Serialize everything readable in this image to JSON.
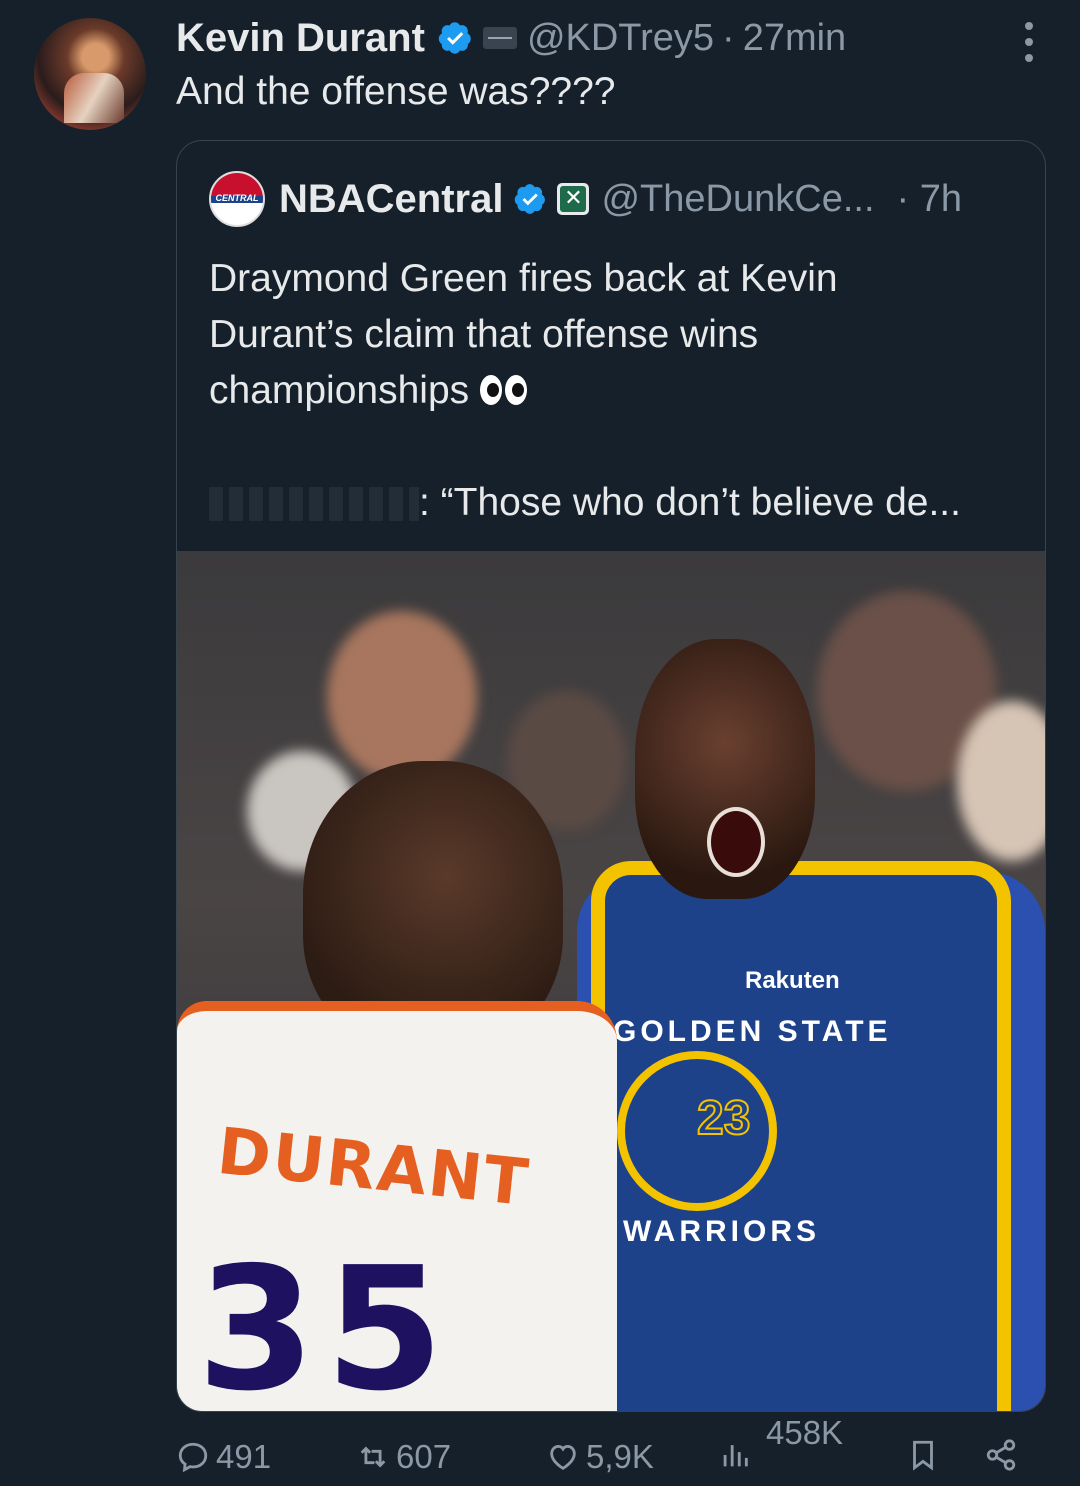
{
  "tweet": {
    "author_name": "Kevin Durant",
    "author_handle": "@KDTrey5",
    "separator": "·",
    "time": "27min",
    "text": "And the offense was????"
  },
  "quote": {
    "author_name": "NBACentral",
    "author_handle": "@TheDunkCe...",
    "time": "· 7h",
    "text_line1": "Draymond Green fires back at Kevin",
    "text_line2": "Durant’s claim that offense wins",
    "text_line3": "championships",
    "text_line4": ": “Those who don’t believe de...",
    "avatar_label": "CENTRAL",
    "photo": {
      "left_jersey_name": "DURANT",
      "left_jersey_number": "35",
      "right_sponsor": "Rakuten",
      "right_team_top": "GOLDEN STATE",
      "right_team_bottom": "WARRIORS",
      "right_jersey_number": "23"
    }
  },
  "actions": {
    "replies": "491",
    "reposts": "607",
    "likes": "5,9K",
    "views": "458K"
  },
  "colors": {
    "background": "#15202b",
    "text": "#e7e9ea",
    "muted": "#8b98a5",
    "verified": "#1d9bf0",
    "border": "#38444d"
  }
}
